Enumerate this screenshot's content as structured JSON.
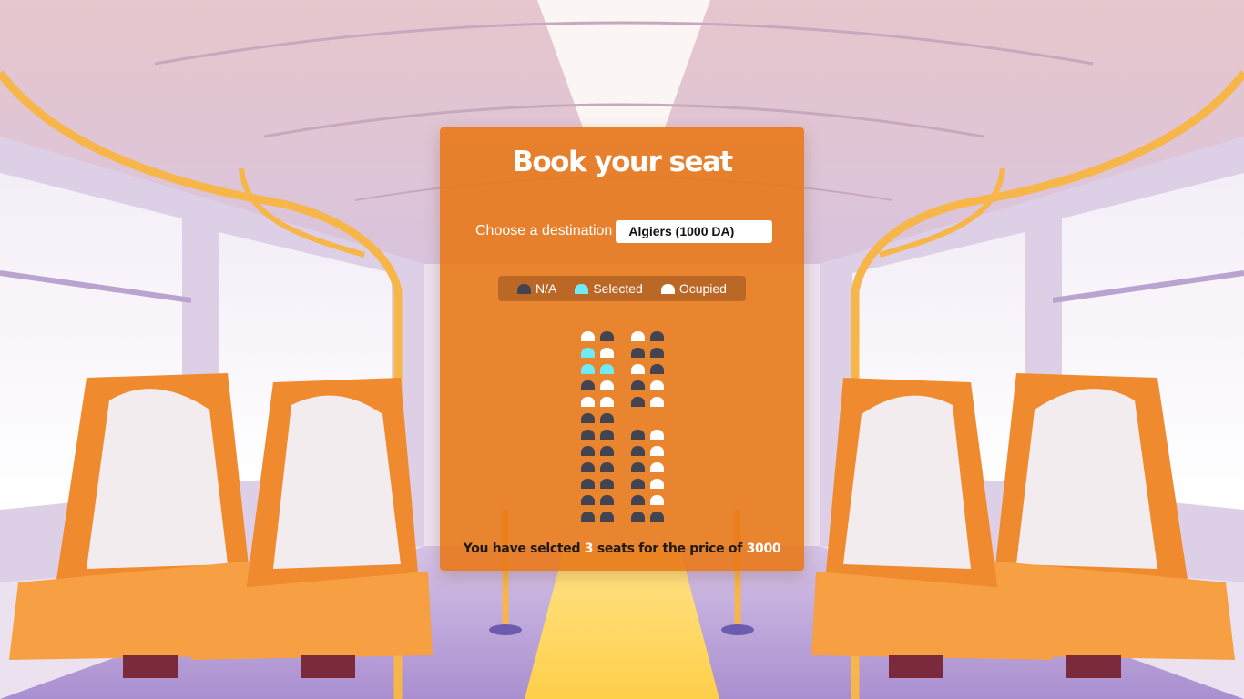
{
  "page": {
    "title": "Book your seat"
  },
  "destination": {
    "label": "Choose a destination",
    "selected": "Algiers (1000 DA)"
  },
  "legend": [
    {
      "label": "N/A",
      "state": "na"
    },
    {
      "label": "Selected",
      "state": "selected"
    },
    {
      "label": "Ocupied",
      "state": "occupied"
    }
  ],
  "seat_map": [
    [
      "O",
      "N",
      "",
      "O",
      "N"
    ],
    [
      "S",
      "O",
      "",
      "N",
      "N"
    ],
    [
      "S",
      "S",
      "",
      "O",
      "N"
    ],
    [
      "N",
      "O",
      "",
      "N",
      "O"
    ],
    [
      "O",
      "O",
      "",
      "N",
      "O"
    ],
    [
      "N",
      "N",
      "",
      "",
      ""
    ],
    [
      "N",
      "N",
      "",
      "N",
      "O"
    ],
    [
      "N",
      "N",
      "",
      "N",
      "O"
    ],
    [
      "N",
      "N",
      "",
      "N",
      "O"
    ],
    [
      "N",
      "N",
      "",
      "N",
      "O"
    ],
    [
      "N",
      "N",
      "",
      "N",
      "O"
    ],
    [
      "N",
      "N",
      "",
      "N",
      "N"
    ]
  ],
  "summary": {
    "prefix": "You have selcted",
    "count": "3",
    "middle": "seats for the price of",
    "price": "3000"
  },
  "colors": {
    "panel": "#e87614",
    "seat_na": "#444451",
    "seat_selected": "#6feaf6",
    "seat_occupied": "#ffffff"
  }
}
